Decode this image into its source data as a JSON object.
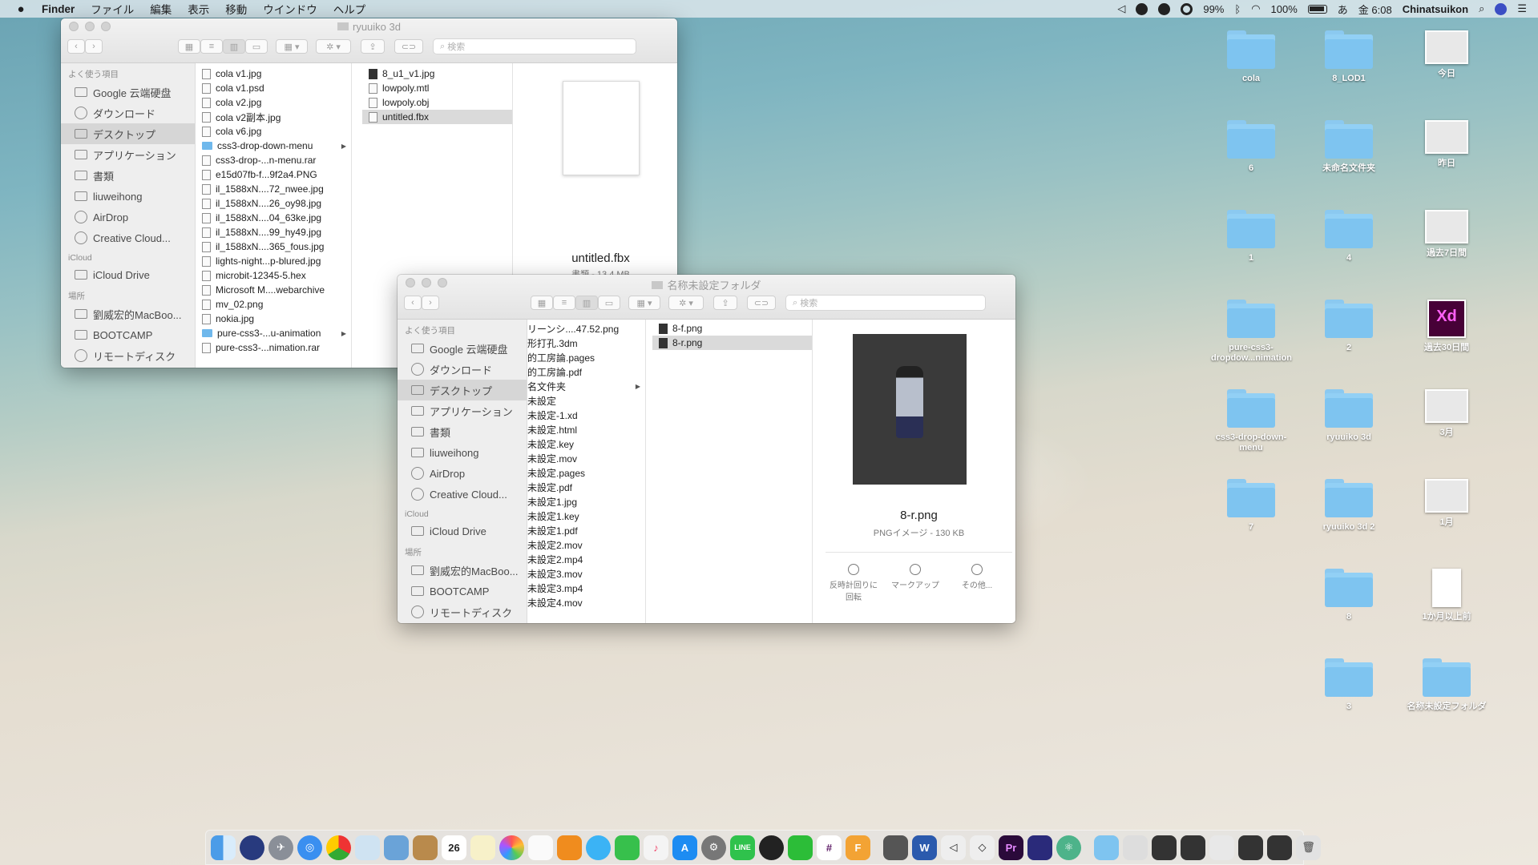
{
  "menubar": {
    "apple": "",
    "app": "Finder",
    "menus": [
      "ファイル",
      "編集",
      "表示",
      "移動",
      "ウインドウ",
      "ヘルプ"
    ],
    "wifi_pct": "99%",
    "battery": "100%",
    "input": "あ",
    "clock": "金 6:08",
    "user": "Chinatsuikon",
    "search_icon": "search-icon"
  },
  "win1": {
    "title": "ryuuiko 3d",
    "search_placeholder": "検索",
    "sidebar": {
      "favorites_header": "よく使う項目",
      "favorites": [
        "Google 云端硬盘",
        "ダウンロード",
        "デスクトップ",
        "アプリケーション",
        "書類",
        "liuweihong",
        "AirDrop",
        "Creative Cloud..."
      ],
      "icloud_header": "iCloud",
      "icloud": [
        "iCloud Drive"
      ],
      "places_header": "場所",
      "places": [
        "劉威宏的MacBoo...",
        "BOOTCAMP",
        "リモートディスク"
      ]
    },
    "col1": [
      {
        "name": "cola v1.jpg",
        "t": "f"
      },
      {
        "name": "cola v1.psd",
        "t": "f"
      },
      {
        "name": "cola v2.jpg",
        "t": "f"
      },
      {
        "name": "cola v2副本.jpg",
        "t": "f"
      },
      {
        "name": "cola v6.jpg",
        "t": "f"
      },
      {
        "name": "css3-drop-down-menu",
        "t": "d"
      },
      {
        "name": "css3-drop-...n-menu.rar",
        "t": "f"
      },
      {
        "name": "e15d07fb-f...9f2a4.PNG",
        "t": "f"
      },
      {
        "name": "il_1588xN....72_nwee.jpg",
        "t": "f"
      },
      {
        "name": "il_1588xN....26_oy98.jpg",
        "t": "f"
      },
      {
        "name": "il_1588xN....04_63ke.jpg",
        "t": "f"
      },
      {
        "name": "il_1588xN....99_hy49.jpg",
        "t": "f"
      },
      {
        "name": "il_1588xN....365_fous.jpg",
        "t": "f"
      },
      {
        "name": "lights-night...p-blured.jpg",
        "t": "f"
      },
      {
        "name": "microbit-12345-5.hex",
        "t": "f"
      },
      {
        "name": "Microsoft M....webarchive",
        "t": "f"
      },
      {
        "name": "mv_02.png",
        "t": "f"
      },
      {
        "name": "nokia.jpg",
        "t": "f"
      },
      {
        "name": "pure-css3-...u-animation",
        "t": "d"
      },
      {
        "name": "pure-css3-...nimation.rar",
        "t": "f"
      }
    ],
    "col2": [
      "8_u1_v1.jpg",
      "lowpoly.mtl",
      "lowpoly.obj",
      "untitled.fbx"
    ],
    "preview_name": "untitled.fbx",
    "preview_sub": "書類 - 13.4 MB"
  },
  "win2": {
    "title": "名称未設定フォルダ",
    "search_placeholder": "検索",
    "sidebar": {
      "favorites_header": "よく使う項目",
      "favorites": [
        "Google 云端硬盘",
        "ダウンロード",
        "デスクトップ",
        "アプリケーション",
        "書類",
        "liuweihong",
        "AirDrop",
        "Creative Cloud..."
      ],
      "icloud_header": "iCloud",
      "icloud": [
        "iCloud Drive"
      ],
      "places_header": "場所",
      "places": [
        "劉威宏的MacBoo...",
        "BOOTCAMP",
        "リモートディスク"
      ]
    },
    "col1": [
      "リーンシ....47.52.png",
      "形打孔.3dm",
      "的工房論.pages",
      "的工房論.pdf",
      "名文件夹",
      "未設定",
      "未設定-1.xd",
      "未設定.html",
      "未設定.key",
      "未設定.mov",
      "未設定.pages",
      "未設定.pdf",
      "未設定1.jpg",
      "未設定1.key",
      "未設定1.pdf",
      "未設定2.mov",
      "未設定2.mp4",
      "未設定3.mov",
      "未設定3.mp4",
      "未設定4.mov"
    ],
    "col2": [
      "8-f.png",
      "8-r.png"
    ],
    "preview_name": "8-r.png",
    "preview_sub": "PNGイメージ - 130 KB",
    "actions": [
      {
        "label": "反時計回りに\n回転"
      },
      {
        "label": "マークアップ"
      },
      {
        "label": "その他..."
      }
    ]
  },
  "desktop": [
    {
      "label": "cola",
      "kind": "folder"
    },
    {
      "label": "8_LOD1",
      "kind": "folder"
    },
    {
      "label": "今日",
      "kind": "stack"
    },
    {
      "label": "6",
      "kind": "folder"
    },
    {
      "label": "未命名文件夹",
      "kind": "folder"
    },
    {
      "label": "昨日",
      "kind": "stack"
    },
    {
      "label": "1",
      "kind": "folder"
    },
    {
      "label": "4",
      "kind": "folder"
    },
    {
      "label": "過去7日間",
      "kind": "stack"
    },
    {
      "label": "pure-css3-dropdow...nimation",
      "kind": "folder"
    },
    {
      "label": "2",
      "kind": "folder"
    },
    {
      "label": "過去30日間",
      "kind": "xd"
    },
    {
      "label": "css3-drop-down-menu",
      "kind": "folder"
    },
    {
      "label": "ryuuiko 3d",
      "kind": "folder"
    },
    {
      "label": "3月",
      "kind": "stack"
    },
    {
      "label": "7",
      "kind": "folder"
    },
    {
      "label": "ryuuiko 3d 2",
      "kind": "folder"
    },
    {
      "label": "1月",
      "kind": "stack"
    },
    {
      "label": "8",
      "kind": "folder"
    },
    {
      "label": "1か月以上前",
      "kind": "zip"
    },
    {
      "label": "3",
      "kind": "folder"
    },
    {
      "label": "名称未設定フォルダ",
      "kind": "folder"
    }
  ],
  "dock": {
    "calendar_day": "26",
    "xd_badge": "Xd"
  },
  "colors": {
    "folder": "#7ec4f0",
    "selection": "#dadada"
  }
}
